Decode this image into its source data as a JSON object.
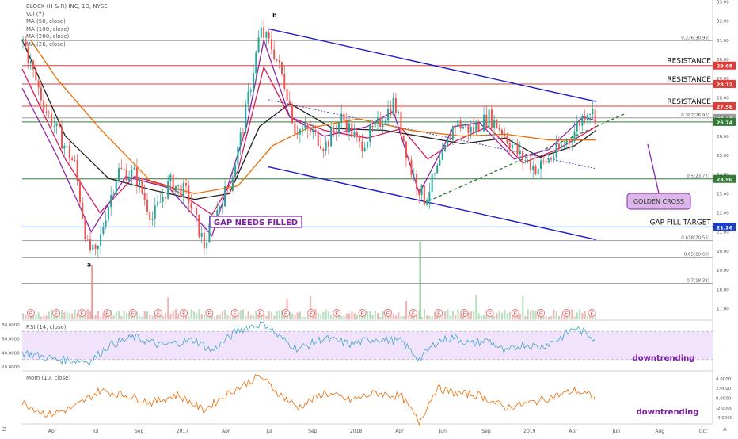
{
  "header": {
    "symbol_line": "BLOCK (H & R) INC, 1D, NYSE",
    "indicators": [
      "Vol (7)",
      "MA (50, close)",
      "MA (100, close)",
      "MA (200, close)",
      "MA (26, close)"
    ]
  },
  "rsi_label": "RSI (14, close)",
  "mom_label": "Mom (10, close)",
  "axis_controls": {
    "log_btn": "Z",
    "auto_btn": "A"
  },
  "chart_data": {
    "type": "candlestick",
    "title": "BLOCK (H & R) INC, 1D, NYSE",
    "x_ticks": [
      "Apr",
      "Jul",
      "Sep",
      "2017",
      "Apr",
      "Jul",
      "Sep",
      "2018",
      "Apr",
      "Jun",
      "Sep",
      "2019",
      "Apr",
      "Jun",
      "Aug",
      "Oct"
    ],
    "y_ticks": [
      17,
      18,
      19,
      20,
      21,
      22,
      23,
      24,
      25,
      26,
      27,
      28,
      29,
      30,
      31,
      32,
      33
    ],
    "ylim": [
      16.4,
      33.1
    ],
    "price_path": [
      [
        0,
        31.0
      ],
      [
        5,
        27.5
      ],
      [
        12,
        24.5
      ],
      [
        15,
        20.2
      ],
      [
        17,
        19.7
      ],
      [
        19,
        21.8
      ],
      [
        22,
        24.2
      ],
      [
        26,
        24.0
      ],
      [
        30,
        21.7
      ],
      [
        34,
        23.6
      ],
      [
        38,
        23.0
      ],
      [
        42,
        20.3
      ],
      [
        46,
        22.7
      ],
      [
        48,
        23.5
      ],
      [
        51,
        26.5
      ],
      [
        55,
        31.5
      ],
      [
        58,
        30.5
      ],
      [
        61,
        28.5
      ],
      [
        63,
        26.4
      ],
      [
        67,
        26.2
      ],
      [
        70,
        25.5
      ],
      [
        74,
        27.0
      ],
      [
        78,
        25.5
      ],
      [
        82,
        26.5
      ],
      [
        86,
        27.8
      ],
      [
        90,
        24.2
      ],
      [
        93,
        22.7
      ],
      [
        97,
        24.7
      ],
      [
        100,
        26.7
      ],
      [
        104,
        26.3
      ],
      [
        108,
        27.0
      ],
      [
        111,
        26.3
      ],
      [
        115,
        25.0
      ],
      [
        119,
        24.3
      ],
      [
        123,
        25.0
      ],
      [
        127,
        26.0
      ],
      [
        131,
        27.5
      ],
      [
        133,
        26.9
      ]
    ],
    "ma_series": [
      {
        "name": "MA (50, close)",
        "color": "#d81b60",
        "values": [
          [
            0,
            29.5
          ],
          [
            10,
            24.8
          ],
          [
            18,
            22.0
          ],
          [
            26,
            23.9
          ],
          [
            34,
            23.4
          ],
          [
            44,
            21.9
          ],
          [
            50,
            24.2
          ],
          [
            56,
            29.6
          ],
          [
            62,
            27.0
          ],
          [
            70,
            26.3
          ],
          [
            80,
            25.9
          ],
          [
            88,
            26.4
          ],
          [
            94,
            24.8
          ],
          [
            100,
            25.7
          ],
          [
            108,
            26.5
          ],
          [
            116,
            24.6
          ],
          [
            124,
            25.3
          ],
          [
            133,
            26.5
          ]
        ]
      },
      {
        "name": "MA (100, close)",
        "color": "#212121",
        "values": [
          [
            0,
            31.0
          ],
          [
            10,
            26.0
          ],
          [
            20,
            23.8
          ],
          [
            30,
            23.2
          ],
          [
            40,
            22.7
          ],
          [
            48,
            23.0
          ],
          [
            55,
            26.5
          ],
          [
            62,
            27.7
          ],
          [
            72,
            26.4
          ],
          [
            84,
            26.3
          ],
          [
            92,
            26.0
          ],
          [
            102,
            25.6
          ],
          [
            112,
            25.9
          ],
          [
            120,
            24.9
          ],
          [
            128,
            25.5
          ],
          [
            133,
            26.3
          ]
        ]
      },
      {
        "name": "MA (200, close)",
        "color": "#ef6c00",
        "values": [
          [
            2,
            31.0
          ],
          [
            8,
            29.0
          ],
          [
            18,
            26.4
          ],
          [
            30,
            23.6
          ],
          [
            40,
            23.0
          ],
          [
            50,
            23.4
          ],
          [
            58,
            25.5
          ],
          [
            66,
            26.4
          ],
          [
            78,
            26.9
          ],
          [
            90,
            26.3
          ],
          [
            102,
            26.0
          ],
          [
            112,
            26.1
          ],
          [
            122,
            25.8
          ],
          [
            133,
            25.8
          ]
        ]
      },
      {
        "name": "MA (26, close)",
        "color": "#8e24aa",
        "values": [
          [
            0,
            28.5
          ],
          [
            8,
            25.0
          ],
          [
            16,
            21.0
          ],
          [
            24,
            23.9
          ],
          [
            34,
            23.3
          ],
          [
            44,
            20.8
          ],
          [
            52,
            26.5
          ],
          [
            56,
            31.0
          ],
          [
            62,
            27.0
          ],
          [
            70,
            26.0
          ],
          [
            80,
            26.5
          ],
          [
            86,
            27.3
          ],
          [
            92,
            23.0
          ],
          [
            100,
            26.5
          ],
          [
            106,
            26.7
          ],
          [
            114,
            24.8
          ],
          [
            122,
            25.3
          ],
          [
            130,
            27.0
          ],
          [
            133,
            26.8
          ]
        ]
      }
    ],
    "levels": [
      {
        "label": "0.236(30.98)",
        "value": 30.98,
        "color": "#9e9e9e",
        "badge": "",
        "note": ""
      },
      {
        "label": "",
        "value": 29.68,
        "color": "#e53935",
        "badge": "29.68",
        "note": "RESISTANCE"
      },
      {
        "label": "",
        "value": 28.72,
        "color": "#e53935",
        "badge": "28.72",
        "note": "RESISTANCE"
      },
      {
        "label": "",
        "value": 27.56,
        "color": "#e53935",
        "badge": "27.56",
        "note": "RESISTANCE"
      },
      {
        "label": "0.382(26.95)",
        "value": 26.95,
        "color": "#9e9e9e",
        "badge": "26.94",
        "note": ""
      },
      {
        "label": "",
        "value": 26.74,
        "color": "#2e7d32",
        "badge": "26.74",
        "note": ""
      },
      {
        "label": "0.5(23.77)",
        "value": 23.77,
        "color": "#2e7d32",
        "badge": "23.90",
        "note": ""
      },
      {
        "label": "",
        "value": 21.26,
        "color": "#1a3fcf",
        "badge": "21.26",
        "note": "GAP FILL TARGET"
      },
      {
        "label": "0.618(20.55)",
        "value": 20.55,
        "color": "#9e9e9e",
        "badge": "",
        "note": ""
      },
      {
        "label": "0.65(19.68)",
        "value": 19.68,
        "color": "#9e9e9e",
        "badge": "",
        "note": ""
      },
      {
        "label": "0.7(18.32)",
        "value": 18.32,
        "color": "#9e9e9e",
        "badge": "",
        "note": ""
      }
    ],
    "trend_lines": [
      {
        "name": "channel-upper",
        "color": "#1a1acf",
        "from": [
          57,
          31.6
        ],
        "to": [
          133,
          27.8
        ]
      },
      {
        "name": "channel-lower",
        "color": "#1a1acf",
        "from": [
          57,
          24.4
        ],
        "to": [
          133,
          20.6
        ]
      },
      {
        "name": "support-dashed",
        "color": "#2e7d32",
        "from": [
          93,
          22.5
        ],
        "to": [
          140,
          27.2
        ]
      },
      {
        "name": "mid-dotted",
        "color": "#3949ab",
        "from": [
          57,
          27.9
        ],
        "to": [
          133,
          24.3
        ]
      }
    ],
    "annotations": {
      "wave_a": "a",
      "wave_b": "b",
      "gap_box": "GAP NEEDS FILLED",
      "golden_cross": "GOLDEN CROSS",
      "rsi_note": "downtrending",
      "mom_note": "downtrending"
    },
    "rsi": {
      "y_ticks": [
        "80.0000",
        "60.0000",
        "40.0000",
        "20.0000"
      ],
      "ylim": [
        15,
        85
      ],
      "band": [
        30,
        70
      ],
      "values": [
        [
          0,
          40
        ],
        [
          8,
          30
        ],
        [
          16,
          28
        ],
        [
          20,
          50
        ],
        [
          26,
          62
        ],
        [
          32,
          50
        ],
        [
          40,
          58
        ],
        [
          44,
          42
        ],
        [
          50,
          72
        ],
        [
          56,
          82
        ],
        [
          60,
          60
        ],
        [
          64,
          45
        ],
        [
          70,
          60
        ],
        [
          76,
          52
        ],
        [
          82,
          60
        ],
        [
          88,
          55
        ],
        [
          92,
          30
        ],
        [
          96,
          55
        ],
        [
          100,
          62
        ],
        [
          104,
          52
        ],
        [
          108,
          58
        ],
        [
          112,
          40
        ],
        [
          116,
          52
        ],
        [
          120,
          48
        ],
        [
          124,
          58
        ],
        [
          128,
          75
        ],
        [
          133,
          60
        ]
      ]
    },
    "momentum": {
      "y_ticks": [
        "4.0000",
        "2.0000",
        "0.0000",
        "-2.0000",
        "-4.0000"
      ],
      "ylim": [
        -5.2,
        5.2
      ],
      "values": [
        [
          0,
          -1
        ],
        [
          6,
          -3.5
        ],
        [
          12,
          -2
        ],
        [
          18,
          1.5
        ],
        [
          24,
          0.5
        ],
        [
          30,
          -1
        ],
        [
          36,
          0.6
        ],
        [
          42,
          -2.5
        ],
        [
          48,
          1
        ],
        [
          55,
          4.5
        ],
        [
          60,
          0.5
        ],
        [
          64,
          -2
        ],
        [
          70,
          1
        ],
        [
          76,
          -0.5
        ],
        [
          82,
          1
        ],
        [
          88,
          0.2
        ],
        [
          92,
          -5
        ],
        [
          96,
          2
        ],
        [
          100,
          1
        ],
        [
          106,
          0.5
        ],
        [
          112,
          -2
        ],
        [
          118,
          -1
        ],
        [
          124,
          0.5
        ],
        [
          128,
          1.5
        ],
        [
          133,
          0
        ]
      ]
    },
    "earnings_count": 23,
    "earnings_label": "E"
  }
}
